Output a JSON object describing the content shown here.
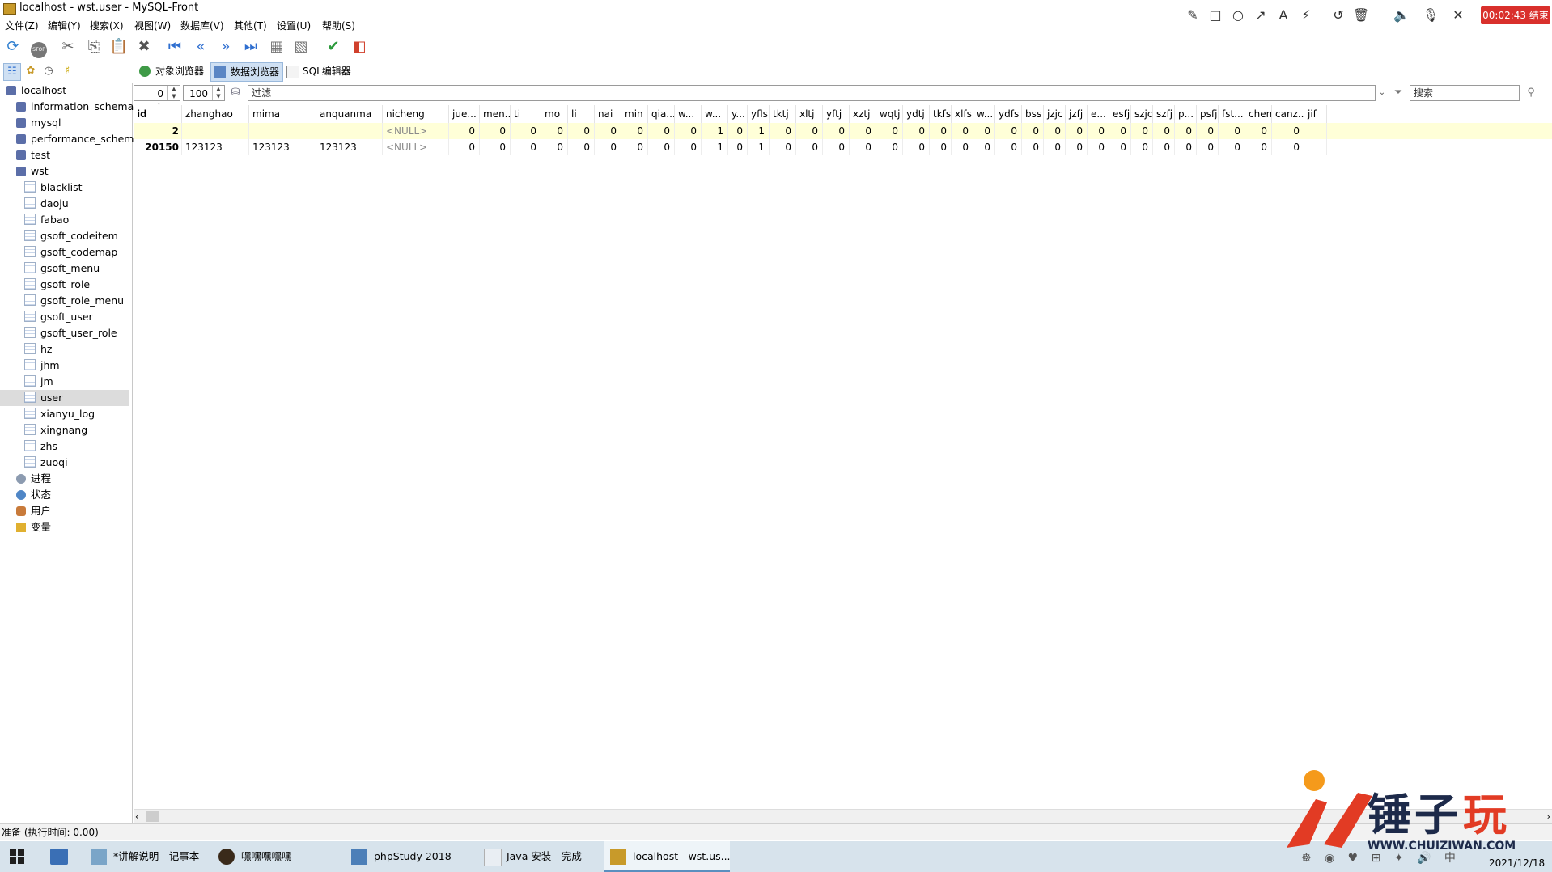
{
  "window": {
    "title": "localhost - wst.user - MySQL-Front"
  },
  "recorder": {
    "timer": "00:02:43 结束"
  },
  "menu": [
    "文件(Z)",
    "编辑(Y)",
    "搜索(X)",
    "视图(W)",
    "数据库(V)",
    "其他(T)",
    "设置(U)",
    "帮助(S)"
  ],
  "tabs": {
    "object_browser": "对象浏览器",
    "data_browser": "数据浏览器",
    "sql_editor": "SQL编辑器"
  },
  "tree": {
    "root": "localhost",
    "databases": [
      "information_schema",
      "mysql",
      "performance_schema",
      "test",
      "wst"
    ],
    "wst_tables": [
      "blacklist",
      "daoju",
      "fabao",
      "gsoft_codeitem",
      "gsoft_codemap",
      "gsoft_menu",
      "gsoft_role",
      "gsoft_role_menu",
      "gsoft_user",
      "gsoft_user_role",
      "hz",
      "jhm",
      "jm",
      "user",
      "xianyu_log",
      "xingnang",
      "zhs",
      "zuoqi"
    ],
    "selected": "user",
    "extras": [
      "进程",
      "状态",
      "用户",
      "变量"
    ]
  },
  "filter": {
    "offset": "0",
    "limit": "100",
    "filter_placeholder": "过滤",
    "search_placeholder": "搜索"
  },
  "grid": {
    "columns": [
      "id",
      "zhanghao",
      "mima",
      "anquanma",
      "nicheng",
      "jue...",
      "men...",
      "ti",
      "mo",
      "li",
      "nai",
      "min",
      "qia...",
      "w...",
      "w...",
      "y...",
      "yfls",
      "tktj",
      "xltj",
      "yftj",
      "xztj",
      "wqtj",
      "ydtj",
      "tkfs",
      "xlfs",
      "w...",
      "ydfs",
      "bss",
      "jzjc",
      "jzfj",
      "e...",
      "esfj",
      "szjc",
      "szfj",
      "p...",
      "psfj",
      "fst...",
      "chen...",
      "canz...",
      "jif"
    ],
    "rows": [
      [
        "2",
        "",
        "",
        "",
        "<NULL>",
        "0",
        "0",
        "0",
        "0",
        "0",
        "0",
        "0",
        "0",
        "0",
        "1",
        "0",
        "1",
        "0",
        "0",
        "0",
        "0",
        "0",
        "0",
        "0",
        "0",
        "0",
        "0",
        "0",
        "0",
        "0",
        "0",
        "0",
        "0",
        "0",
        "0",
        "0",
        "0",
        "0",
        "0",
        ""
      ],
      [
        "20150",
        "123123",
        "123123",
        "123123",
        "<NULL>",
        "0",
        "0",
        "0",
        "0",
        "0",
        "0",
        "0",
        "0",
        "0",
        "1",
        "0",
        "1",
        "0",
        "0",
        "0",
        "0",
        "0",
        "0",
        "0",
        "0",
        "0",
        "0",
        "0",
        "0",
        "0",
        "0",
        "0",
        "0",
        "0",
        "0",
        "0",
        "0",
        "0",
        "0",
        ""
      ]
    ]
  },
  "status": {
    "text": "准备  (执行时间: 0.00)"
  },
  "taskbar": {
    "tasks": [
      "*讲解说明 - 记事本",
      "嘿嘿嘿嘿嘿",
      "phpStudy 2018",
      "Java 安装 - 完成",
      "localhost - wst.us..."
    ],
    "date": "2021/12/18"
  },
  "watermark": {
    "text": "锤子玩",
    "url": "WWW.CHUIZIWAN.COM"
  },
  "colors": {
    "timer_bg": "#d9302c",
    "selected_row": "#ffffd8",
    "tab_active": "#cfe0f3"
  }
}
